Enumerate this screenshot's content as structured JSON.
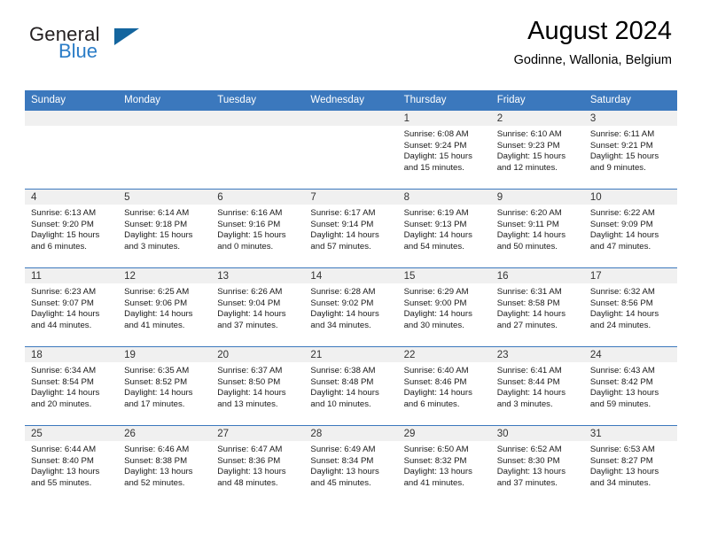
{
  "logo": {
    "text_primary": "General",
    "text_secondary": "Blue",
    "triangle_icon": "triangle-icon",
    "color_primary": "#231f20",
    "color_secondary": "#2a7cc7",
    "color_triangle": "#14659e"
  },
  "header": {
    "title": "August 2024",
    "subtitle": "Godinne, Wallonia, Belgium"
  },
  "theme": {
    "header_row_bg": "#3b78bd",
    "header_row_text": "#ffffff",
    "daynum_band_bg": "#f0f0f0",
    "cell_border": "#3b78bd",
    "page_bg": "#ffffff"
  },
  "weekday_headers": [
    "Sunday",
    "Monday",
    "Tuesday",
    "Wednesday",
    "Thursday",
    "Friday",
    "Saturday"
  ],
  "weeks": [
    [
      {
        "day": "",
        "sunrise": "",
        "sunset": "",
        "daylight_line1": "",
        "daylight_line2": "",
        "empty": true
      },
      {
        "day": "",
        "sunrise": "",
        "sunset": "",
        "daylight_line1": "",
        "daylight_line2": "",
        "empty": true
      },
      {
        "day": "",
        "sunrise": "",
        "sunset": "",
        "daylight_line1": "",
        "daylight_line2": "",
        "empty": true
      },
      {
        "day": "",
        "sunrise": "",
        "sunset": "",
        "daylight_line1": "",
        "daylight_line2": "",
        "empty": true
      },
      {
        "day": "1",
        "sunrise": "Sunrise: 6:08 AM",
        "sunset": "Sunset: 9:24 PM",
        "daylight_line1": "Daylight: 15 hours",
        "daylight_line2": "and 15 minutes.",
        "empty": false
      },
      {
        "day": "2",
        "sunrise": "Sunrise: 6:10 AM",
        "sunset": "Sunset: 9:23 PM",
        "daylight_line1": "Daylight: 15 hours",
        "daylight_line2": "and 12 minutes.",
        "empty": false
      },
      {
        "day": "3",
        "sunrise": "Sunrise: 6:11 AM",
        "sunset": "Sunset: 9:21 PM",
        "daylight_line1": "Daylight: 15 hours",
        "daylight_line2": "and 9 minutes.",
        "empty": false
      }
    ],
    [
      {
        "day": "4",
        "sunrise": "Sunrise: 6:13 AM",
        "sunset": "Sunset: 9:20 PM",
        "daylight_line1": "Daylight: 15 hours",
        "daylight_line2": "and 6 minutes.",
        "empty": false
      },
      {
        "day": "5",
        "sunrise": "Sunrise: 6:14 AM",
        "sunset": "Sunset: 9:18 PM",
        "daylight_line1": "Daylight: 15 hours",
        "daylight_line2": "and 3 minutes.",
        "empty": false
      },
      {
        "day": "6",
        "sunrise": "Sunrise: 6:16 AM",
        "sunset": "Sunset: 9:16 PM",
        "daylight_line1": "Daylight: 15 hours",
        "daylight_line2": "and 0 minutes.",
        "empty": false
      },
      {
        "day": "7",
        "sunrise": "Sunrise: 6:17 AM",
        "sunset": "Sunset: 9:14 PM",
        "daylight_line1": "Daylight: 14 hours",
        "daylight_line2": "and 57 minutes.",
        "empty": false
      },
      {
        "day": "8",
        "sunrise": "Sunrise: 6:19 AM",
        "sunset": "Sunset: 9:13 PM",
        "daylight_line1": "Daylight: 14 hours",
        "daylight_line2": "and 54 minutes.",
        "empty": false
      },
      {
        "day": "9",
        "sunrise": "Sunrise: 6:20 AM",
        "sunset": "Sunset: 9:11 PM",
        "daylight_line1": "Daylight: 14 hours",
        "daylight_line2": "and 50 minutes.",
        "empty": false
      },
      {
        "day": "10",
        "sunrise": "Sunrise: 6:22 AM",
        "sunset": "Sunset: 9:09 PM",
        "daylight_line1": "Daylight: 14 hours",
        "daylight_line2": "and 47 minutes.",
        "empty": false
      }
    ],
    [
      {
        "day": "11",
        "sunrise": "Sunrise: 6:23 AM",
        "sunset": "Sunset: 9:07 PM",
        "daylight_line1": "Daylight: 14 hours",
        "daylight_line2": "and 44 minutes.",
        "empty": false
      },
      {
        "day": "12",
        "sunrise": "Sunrise: 6:25 AM",
        "sunset": "Sunset: 9:06 PM",
        "daylight_line1": "Daylight: 14 hours",
        "daylight_line2": "and 41 minutes.",
        "empty": false
      },
      {
        "day": "13",
        "sunrise": "Sunrise: 6:26 AM",
        "sunset": "Sunset: 9:04 PM",
        "daylight_line1": "Daylight: 14 hours",
        "daylight_line2": "and 37 minutes.",
        "empty": false
      },
      {
        "day": "14",
        "sunrise": "Sunrise: 6:28 AM",
        "sunset": "Sunset: 9:02 PM",
        "daylight_line1": "Daylight: 14 hours",
        "daylight_line2": "and 34 minutes.",
        "empty": false
      },
      {
        "day": "15",
        "sunrise": "Sunrise: 6:29 AM",
        "sunset": "Sunset: 9:00 PM",
        "daylight_line1": "Daylight: 14 hours",
        "daylight_line2": "and 30 minutes.",
        "empty": false
      },
      {
        "day": "16",
        "sunrise": "Sunrise: 6:31 AM",
        "sunset": "Sunset: 8:58 PM",
        "daylight_line1": "Daylight: 14 hours",
        "daylight_line2": "and 27 minutes.",
        "empty": false
      },
      {
        "day": "17",
        "sunrise": "Sunrise: 6:32 AM",
        "sunset": "Sunset: 8:56 PM",
        "daylight_line1": "Daylight: 14 hours",
        "daylight_line2": "and 24 minutes.",
        "empty": false
      }
    ],
    [
      {
        "day": "18",
        "sunrise": "Sunrise: 6:34 AM",
        "sunset": "Sunset: 8:54 PM",
        "daylight_line1": "Daylight: 14 hours",
        "daylight_line2": "and 20 minutes.",
        "empty": false
      },
      {
        "day": "19",
        "sunrise": "Sunrise: 6:35 AM",
        "sunset": "Sunset: 8:52 PM",
        "daylight_line1": "Daylight: 14 hours",
        "daylight_line2": "and 17 minutes.",
        "empty": false
      },
      {
        "day": "20",
        "sunrise": "Sunrise: 6:37 AM",
        "sunset": "Sunset: 8:50 PM",
        "daylight_line1": "Daylight: 14 hours",
        "daylight_line2": "and 13 minutes.",
        "empty": false
      },
      {
        "day": "21",
        "sunrise": "Sunrise: 6:38 AM",
        "sunset": "Sunset: 8:48 PM",
        "daylight_line1": "Daylight: 14 hours",
        "daylight_line2": "and 10 minutes.",
        "empty": false
      },
      {
        "day": "22",
        "sunrise": "Sunrise: 6:40 AM",
        "sunset": "Sunset: 8:46 PM",
        "daylight_line1": "Daylight: 14 hours",
        "daylight_line2": "and 6 minutes.",
        "empty": false
      },
      {
        "day": "23",
        "sunrise": "Sunrise: 6:41 AM",
        "sunset": "Sunset: 8:44 PM",
        "daylight_line1": "Daylight: 14 hours",
        "daylight_line2": "and 3 minutes.",
        "empty": false
      },
      {
        "day": "24",
        "sunrise": "Sunrise: 6:43 AM",
        "sunset": "Sunset: 8:42 PM",
        "daylight_line1": "Daylight: 13 hours",
        "daylight_line2": "and 59 minutes.",
        "empty": false
      }
    ],
    [
      {
        "day": "25",
        "sunrise": "Sunrise: 6:44 AM",
        "sunset": "Sunset: 8:40 PM",
        "daylight_line1": "Daylight: 13 hours",
        "daylight_line2": "and 55 minutes.",
        "empty": false
      },
      {
        "day": "26",
        "sunrise": "Sunrise: 6:46 AM",
        "sunset": "Sunset: 8:38 PM",
        "daylight_line1": "Daylight: 13 hours",
        "daylight_line2": "and 52 minutes.",
        "empty": false
      },
      {
        "day": "27",
        "sunrise": "Sunrise: 6:47 AM",
        "sunset": "Sunset: 8:36 PM",
        "daylight_line1": "Daylight: 13 hours",
        "daylight_line2": "and 48 minutes.",
        "empty": false
      },
      {
        "day": "28",
        "sunrise": "Sunrise: 6:49 AM",
        "sunset": "Sunset: 8:34 PM",
        "daylight_line1": "Daylight: 13 hours",
        "daylight_line2": "and 45 minutes.",
        "empty": false
      },
      {
        "day": "29",
        "sunrise": "Sunrise: 6:50 AM",
        "sunset": "Sunset: 8:32 PM",
        "daylight_line1": "Daylight: 13 hours",
        "daylight_line2": "and 41 minutes.",
        "empty": false
      },
      {
        "day": "30",
        "sunrise": "Sunrise: 6:52 AM",
        "sunset": "Sunset: 8:30 PM",
        "daylight_line1": "Daylight: 13 hours",
        "daylight_line2": "and 37 minutes.",
        "empty": false
      },
      {
        "day": "31",
        "sunrise": "Sunrise: 6:53 AM",
        "sunset": "Sunset: 8:27 PM",
        "daylight_line1": "Daylight: 13 hours",
        "daylight_line2": "and 34 minutes.",
        "empty": false
      }
    ]
  ]
}
